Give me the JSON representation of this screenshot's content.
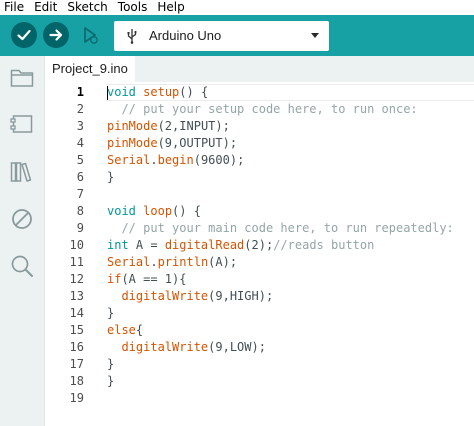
{
  "menu": {
    "items": [
      "File",
      "Edit",
      "Sketch",
      "Tools",
      "Help"
    ]
  },
  "toolbar": {
    "verify_icon": "checkmark-icon",
    "upload_icon": "arrow-right-icon",
    "debugger_icon": "debug-icon",
    "board_icon": "usb-icon",
    "board_name": "Arduino Uno",
    "accent_color": "#17a1a5",
    "button_color": "#006468"
  },
  "sidebar": {
    "icons": [
      "folder-icon",
      "board-manager-icon",
      "library-icon",
      "debug-disabled-icon",
      "search-icon"
    ]
  },
  "tabs": [
    {
      "label": "Project_9.ino"
    }
  ],
  "editor": {
    "active_line": 1,
    "lines": [
      {
        "num": "1",
        "tokens": [
          {
            "t": "void",
            "c": "kw"
          },
          {
            "t": " "
          },
          {
            "t": "setup",
            "c": "fn"
          },
          {
            "t": "() {"
          }
        ]
      },
      {
        "num": "2",
        "tokens": [
          {
            "t": "  // put your setup code here, to run once:",
            "c": "cm"
          }
        ]
      },
      {
        "num": "3",
        "tokens": [
          {
            "t": "pinMode",
            "c": "fn"
          },
          {
            "t": "(2,"
          },
          {
            "t": "INPUT",
            "c": ""
          },
          {
            "t": ");"
          }
        ]
      },
      {
        "num": "4",
        "tokens": [
          {
            "t": "pinMode",
            "c": "fn"
          },
          {
            "t": "(9,"
          },
          {
            "t": "OUTPUT",
            "c": ""
          },
          {
            "t": ");"
          }
        ]
      },
      {
        "num": "5",
        "tokens": [
          {
            "t": "Serial",
            "c": "fn"
          },
          {
            "t": "."
          },
          {
            "t": "begin",
            "c": "fn"
          },
          {
            "t": "(9600);"
          }
        ]
      },
      {
        "num": "6",
        "tokens": [
          {
            "t": "}"
          }
        ]
      },
      {
        "num": "7",
        "tokens": []
      },
      {
        "num": "8",
        "tokens": [
          {
            "t": "void",
            "c": "kw"
          },
          {
            "t": " "
          },
          {
            "t": "loop",
            "c": "fn"
          },
          {
            "t": "() {"
          }
        ]
      },
      {
        "num": "9",
        "tokens": [
          {
            "t": "  // put your main code here, to run repeatedly:",
            "c": "cm"
          }
        ]
      },
      {
        "num": "10",
        "tokens": [
          {
            "t": "int",
            "c": "kw"
          },
          {
            "t": " A = "
          },
          {
            "t": "digitalRead",
            "c": "fn"
          },
          {
            "t": "(2);"
          },
          {
            "t": "//reads button",
            "c": "cm"
          }
        ]
      },
      {
        "num": "11",
        "tokens": [
          {
            "t": "Serial",
            "c": "fn"
          },
          {
            "t": "."
          },
          {
            "t": "println",
            "c": "fn"
          },
          {
            "t": "(A);"
          }
        ]
      },
      {
        "num": "12",
        "tokens": [
          {
            "t": "if",
            "c": "fn"
          },
          {
            "t": "(A == 1){"
          }
        ]
      },
      {
        "num": "13",
        "tokens": [
          {
            "t": "  "
          },
          {
            "t": "digitalWrite",
            "c": "fn"
          },
          {
            "t": "(9,HIGH);"
          }
        ]
      },
      {
        "num": "14",
        "tokens": [
          {
            "t": "}"
          }
        ]
      },
      {
        "num": "15",
        "tokens": [
          {
            "t": "else",
            "c": "fn"
          },
          {
            "t": "{"
          }
        ]
      },
      {
        "num": "16",
        "tokens": [
          {
            "t": "  "
          },
          {
            "t": "digitalWrite",
            "c": "fn"
          },
          {
            "t": "(9,LOW);"
          }
        ]
      },
      {
        "num": "17",
        "tokens": [
          {
            "t": "}"
          }
        ]
      },
      {
        "num": "18",
        "tokens": [
          {
            "t": "}"
          }
        ]
      },
      {
        "num": "19",
        "tokens": []
      }
    ]
  }
}
